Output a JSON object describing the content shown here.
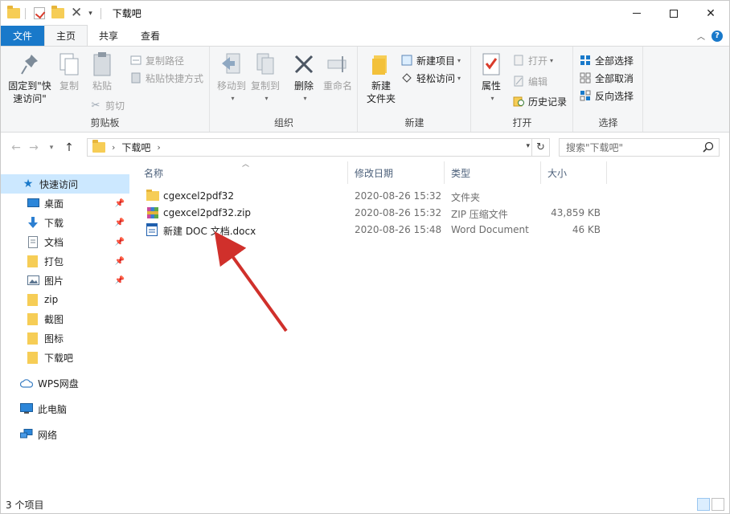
{
  "window": {
    "title": "下载吧"
  },
  "ribbon_tabs": [
    {
      "label": "文件"
    },
    {
      "label": "主页"
    },
    {
      "label": "共享"
    },
    {
      "label": "查看"
    }
  ],
  "ribbon": {
    "clipboard": {
      "label": "剪贴板",
      "pin_quick": "固定到\"快速访问\"",
      "copy": "复制",
      "paste": "粘贴",
      "copy_path": "复制路径",
      "paste_shortcut": "粘贴快捷方式",
      "cut": "剪切"
    },
    "organize": {
      "label": "组织",
      "move_to": "移动到",
      "copy_to": "复制到",
      "delete": "删除",
      "rename": "重命名"
    },
    "new": {
      "label": "新建",
      "new_folder": "新建\n文件夹",
      "new_item": "新建项目",
      "easy_access": "轻松访问"
    },
    "open": {
      "label": "打开",
      "properties": "属性",
      "open": "打开",
      "edit": "编辑",
      "history": "历史记录"
    },
    "select": {
      "label": "选择",
      "select_all": "全部选择",
      "select_none": "全部取消",
      "invert": "反向选择"
    }
  },
  "address": {
    "crumb": "下载吧",
    "search_placeholder": "搜索\"下载吧\""
  },
  "nav": {
    "quick_access": "快速访问",
    "items": [
      {
        "label": "桌面",
        "pinned": true
      },
      {
        "label": "下载",
        "pinned": true
      },
      {
        "label": "文档",
        "pinned": true
      },
      {
        "label": "打包",
        "pinned": true
      },
      {
        "label": "图片",
        "pinned": true
      },
      {
        "label": "zip",
        "pinned": false
      },
      {
        "label": "截图",
        "pinned": false
      },
      {
        "label": "图标",
        "pinned": false
      },
      {
        "label": "下载吧",
        "pinned": false
      }
    ],
    "wps": "WPS网盘",
    "this_pc": "此电脑",
    "network": "网络"
  },
  "columns": {
    "name": "名称",
    "date": "修改日期",
    "type": "类型",
    "size": "大小"
  },
  "files": [
    {
      "name": "cgexcel2pdf32",
      "date": "2020-08-26 15:32",
      "type": "文件夹",
      "size": "",
      "icon": "folder-icon"
    },
    {
      "name": "cgexcel2pdf32.zip",
      "date": "2020-08-26 15:32",
      "type": "ZIP 压缩文件",
      "size": "43,859 KB",
      "icon": "zip-icon"
    },
    {
      "name": "新建 DOC 文档.docx",
      "date": "2020-08-26 15:48",
      "type": "Word Document",
      "size": "46 KB",
      "icon": "docx-icon"
    }
  ],
  "status": {
    "count": "3 个项目"
  },
  "colors": {
    "accent": "#1979ca",
    "selection": "#cce8ff",
    "arrow": "#d0302b",
    "folder": "#f6cd56"
  }
}
